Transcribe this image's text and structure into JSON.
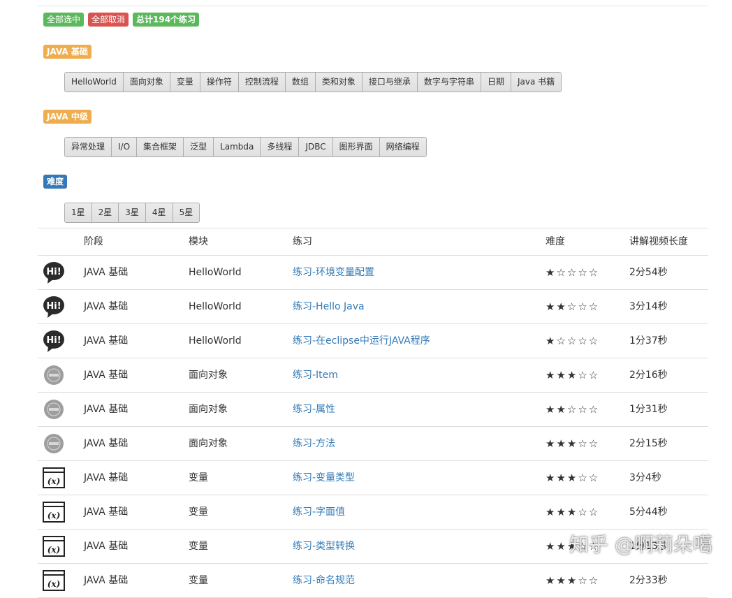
{
  "actions": {
    "select_all": "全部选中",
    "cancel_all": "全部取消",
    "total": "总计194个练习"
  },
  "sections": [
    {
      "label": "JAVA 基础",
      "buttons": [
        "HelloWorld",
        "面向对象",
        "变量",
        "操作符",
        "控制流程",
        "数组",
        "类和对象",
        "接口与继承",
        "数字与字符串",
        "日期",
        "Java 书籍"
      ]
    },
    {
      "label": "JAVA 中级",
      "buttons": [
        "异常处理",
        "I/O",
        "集合框架",
        "泛型",
        "Lambda",
        "多线程",
        "JDBC",
        "图形界面",
        "网络编程"
      ]
    }
  ],
  "difficulty": {
    "label": "难度",
    "buttons": [
      "1星",
      "2星",
      "3星",
      "4星",
      "5星"
    ]
  },
  "table": {
    "headers": [
      "阶段",
      "模块",
      "练习",
      "难度",
      "讲解视频长度"
    ],
    "rows": [
      {
        "icon": "hi-bubble-icon",
        "stage": "JAVA 基础",
        "module": "HelloWorld",
        "exercise": "练习-环境变量配置",
        "stars": "★☆☆☆☆",
        "length": "2分54秒"
      },
      {
        "icon": "hi-bubble-icon",
        "stage": "JAVA 基础",
        "module": "HelloWorld",
        "exercise": "练习-Hello Java",
        "stars": "★★☆☆☆",
        "length": "3分14秒"
      },
      {
        "icon": "hi-bubble-icon",
        "stage": "JAVA 基础",
        "module": "HelloWorld",
        "exercise": "练习-在eclipse中运行JAVA程序",
        "stars": "★☆☆☆☆",
        "length": "1分37秒"
      },
      {
        "icon": "oop-circle-icon",
        "stage": "JAVA 基础",
        "module": "面向对象",
        "exercise": "练习-Item",
        "stars": "★★★☆☆",
        "length": "2分16秒"
      },
      {
        "icon": "oop-circle-icon",
        "stage": "JAVA 基础",
        "module": "面向对象",
        "exercise": "练习-属性",
        "stars": "★★☆☆☆",
        "length": "1分31秒"
      },
      {
        "icon": "oop-circle-icon",
        "stage": "JAVA 基础",
        "module": "面向对象",
        "exercise": "练习-方法",
        "stars": "★★★☆☆",
        "length": "2分15秒"
      },
      {
        "icon": "variable-x-icon",
        "stage": "JAVA 基础",
        "module": "变量",
        "exercise": "练习-变量类型",
        "stars": "★★★☆☆",
        "length": "3分4秒"
      },
      {
        "icon": "variable-x-icon",
        "stage": "JAVA 基础",
        "module": "变量",
        "exercise": "练习-字面值",
        "stars": "★★★☆☆",
        "length": "5分44秒"
      },
      {
        "icon": "variable-x-icon",
        "stage": "JAVA 基础",
        "module": "变量",
        "exercise": "练习-类型转换",
        "stars": "★★★☆☆",
        "length": "1分13秒"
      },
      {
        "icon": "variable-x-icon",
        "stage": "JAVA 基础",
        "module": "变量",
        "exercise": "练习-命名规范",
        "stars": "★★★☆☆",
        "length": "2分33秒"
      }
    ]
  },
  "watermark": "知乎 @啊莉朵噶"
}
